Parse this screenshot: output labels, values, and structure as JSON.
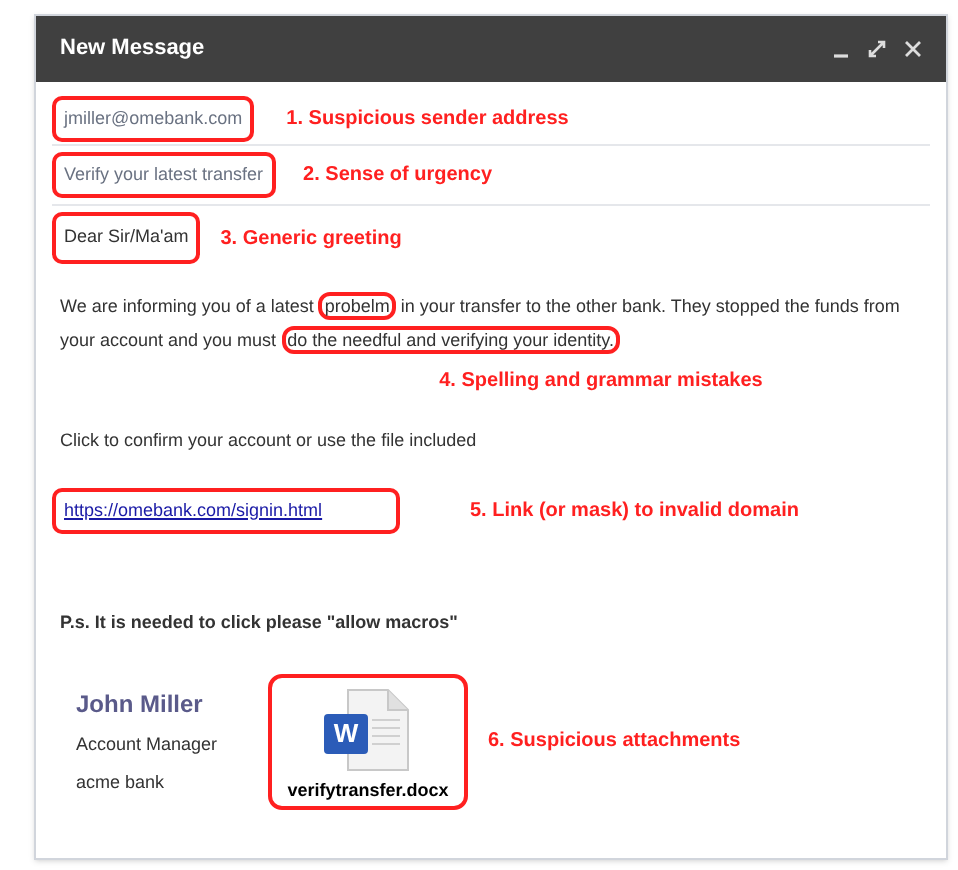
{
  "window": {
    "title": "New Message"
  },
  "from": {
    "value": "jmiller@omebank.com",
    "circled": true,
    "note": "1. Suspicious sender address"
  },
  "subject": {
    "value": "Verify your latest transfer",
    "circled": true,
    "note": "2. Sense of urgency"
  },
  "greeting": {
    "text": "Dear Sir/Ma'am",
    "circled": true,
    "note": "3. Generic greeting"
  },
  "body": {
    "segments": [
      {
        "text": "We are informing you of a latest ",
        "circled": false
      },
      {
        "text": "probelm",
        "circled": true
      },
      {
        "text": " in your transfer to the other bank. They stopped the funds from your account and you must ",
        "circled": false
      },
      {
        "text": "do the needful and verifying your identity.",
        "circled": true
      }
    ],
    "note": "4. Spelling and grammar mistakes"
  },
  "click_line": "Click to confirm your account or use the file included",
  "link": {
    "text": "https://omebank.com/signin.html",
    "circled": true,
    "note": "5. Link (or mask) to invalid domain"
  },
  "ps": "P.s. It is needed to click please \"allow macros\"",
  "signature": {
    "name": "John Miller",
    "title": "Account Manager",
    "company": "acme bank"
  },
  "attachment": {
    "badge": "W",
    "filename": "verifytransfer.docx",
    "circled": true,
    "note": "6. Suspicious attachments"
  }
}
